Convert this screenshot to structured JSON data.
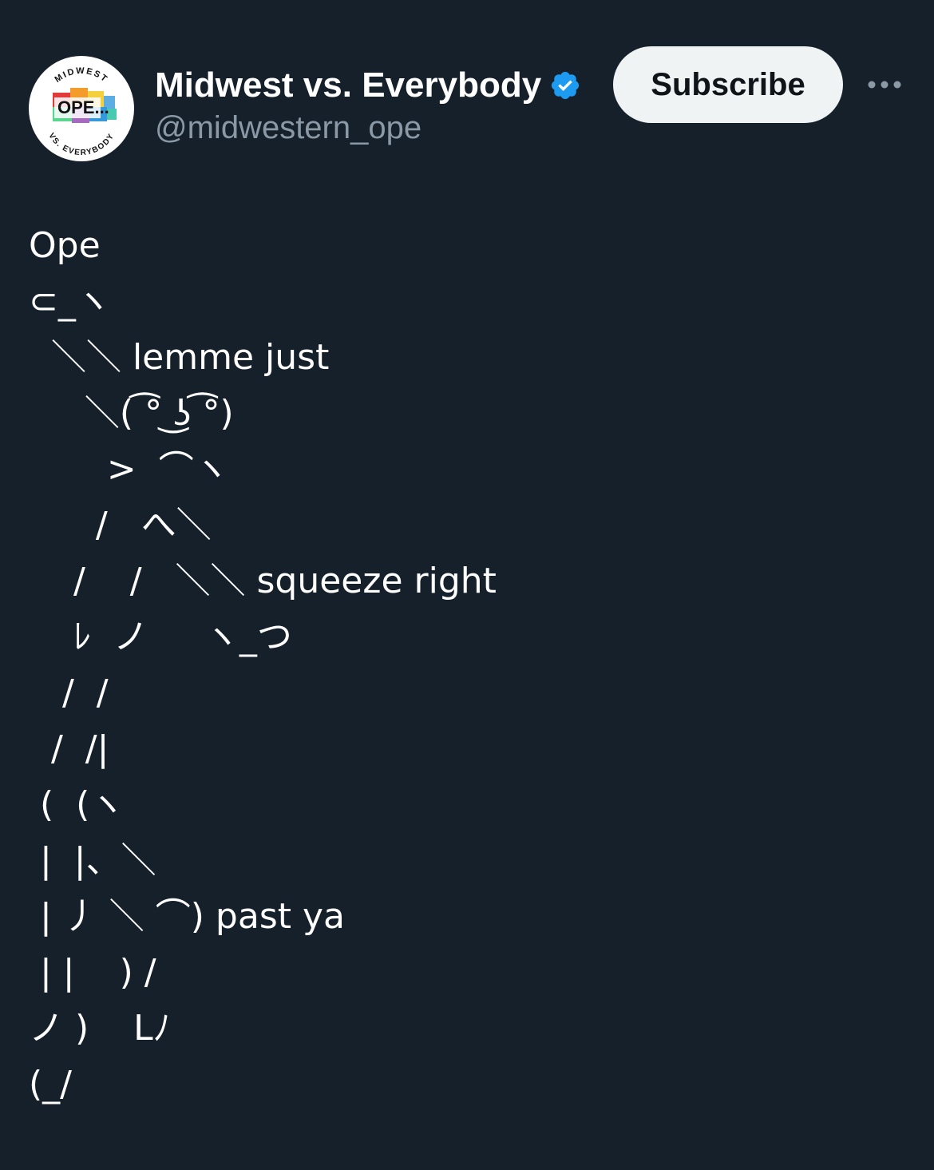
{
  "header": {
    "display_name": "Midwest vs. Everybody",
    "handle": "@midwestern_ope",
    "verified": true,
    "verified_color": "#1d9bf0",
    "subscribe_label": "Subscribe",
    "more_icon": "more-horizontal-icon",
    "avatar": {
      "top_text": "MIDWEST",
      "center_text": "OPE...",
      "bottom_text": "VS. EVERYBODY"
    }
  },
  "tweet": {
    "lines": [
      "Ope",
      "⊂_ヽ",
      "  ＼＼ lemme just",
      "     ＼( ͡° ͜ʖ ͡°)",
      "       >  ⌒ヽ",
      "      /   へ＼",
      "    /    /   ＼＼ squeeze right",
      "    ﾚ  ノ     ヽ_つ",
      "   /  /",
      "  /  /|",
      " (  (ヽ",
      " |  |、＼",
      " | 丿 ＼ ⌒) past ya",
      " | |    ) /",
      "ノ )    Lﾉ",
      "(_/"
    ]
  },
  "colors": {
    "background": "#15202b",
    "text": "#ffffff",
    "secondary_text": "#8b98a5",
    "button_bg": "#eff3f4",
    "button_text": "#0f1419"
  }
}
